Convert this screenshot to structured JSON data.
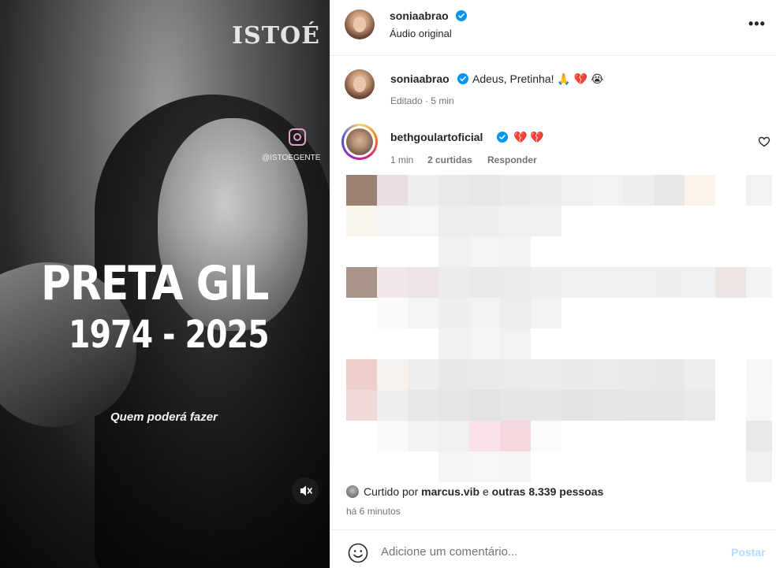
{
  "video": {
    "logo": "ISTOÉ",
    "handle": "@ISTOEGENTE",
    "title": "PRETA GIL",
    "years": "1974 - 2025",
    "caption": "Quem poderá fazer",
    "mute_icon": "speaker-muted-icon"
  },
  "header": {
    "username": "soniaabrao",
    "subtitle": "Áudio original",
    "more_icon": "more-options-icon",
    "more_label": "•••"
  },
  "caption": {
    "username": "soniaabrao",
    "text": "Adeus, Pretinha!",
    "emojis": [
      "🙏",
      "💔",
      "😭"
    ],
    "edited": "Editado",
    "time": "5 min"
  },
  "comments": [
    {
      "username": "bethgoulartoficial",
      "emojis": [
        "💔",
        "💔"
      ],
      "time": "1 min",
      "likes": "2 curtidas",
      "reply": "Responder"
    }
  ],
  "likes": {
    "prefix": "Curtido por",
    "user": "marcus.vib",
    "joiner": "e",
    "others": "outras 8.339 pessoas"
  },
  "posted_ago": "há 6 minutos",
  "comment_box": {
    "placeholder": "Adicione um comentário...",
    "post_label": "Postar"
  },
  "colors": {
    "verified": "#0095f6",
    "post_disabled": "#b3dbff",
    "secondary_text": "#737373"
  }
}
